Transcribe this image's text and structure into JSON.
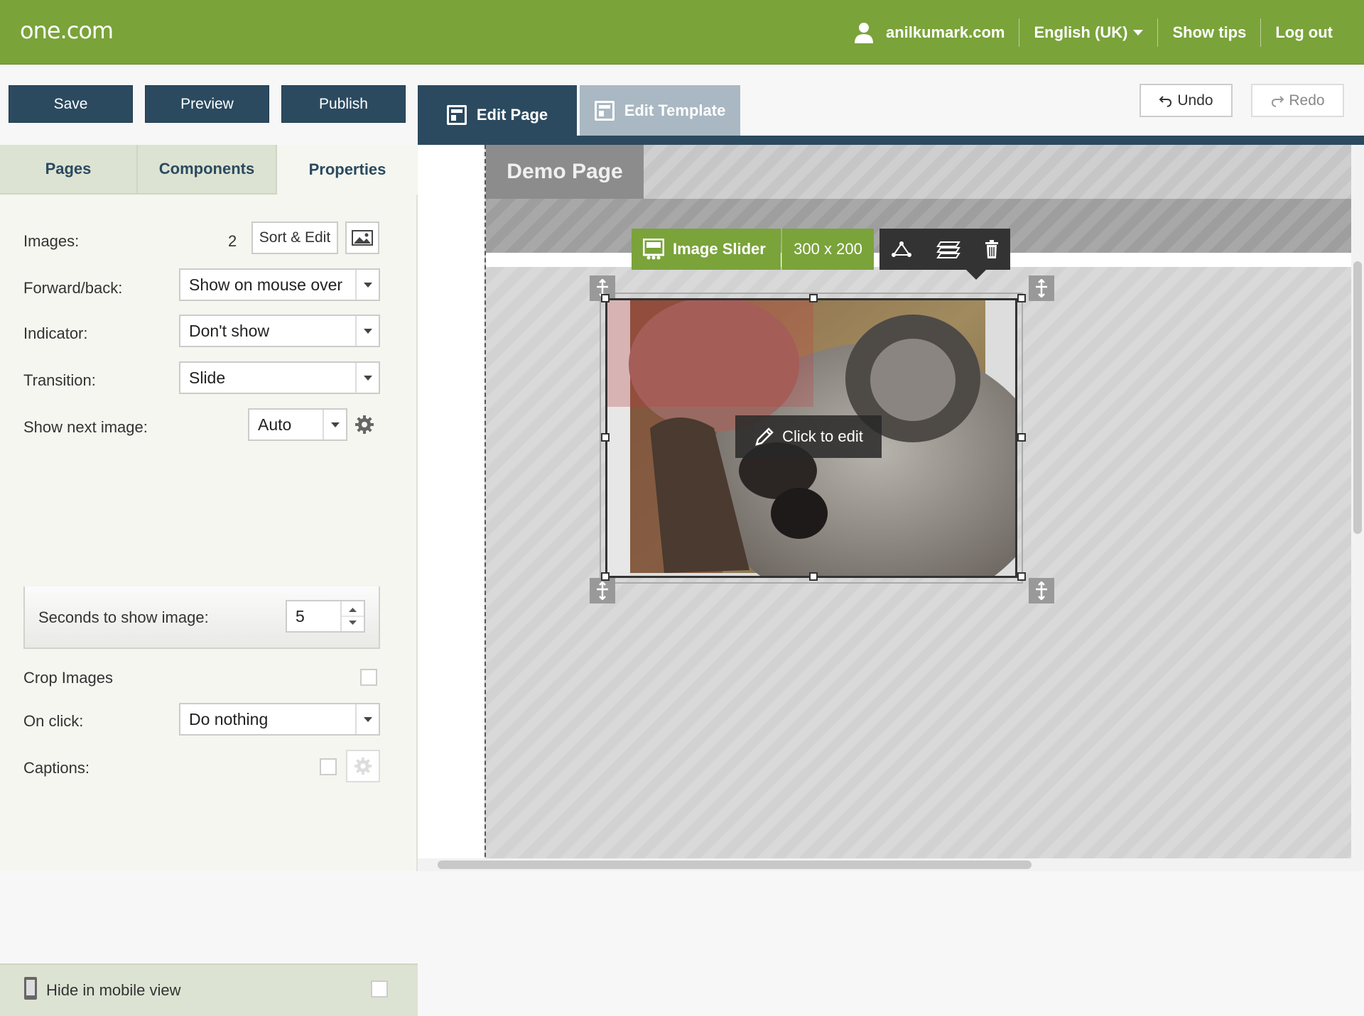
{
  "brand": {
    "logo": "one.com"
  },
  "topnav": {
    "user": "anilkumark.com",
    "language": "English (UK)",
    "show_tips": "Show tips",
    "logout": "Log out"
  },
  "toolbar": {
    "save": "Save",
    "preview": "Preview",
    "publish": "Publish",
    "edit_page": "Edit Page",
    "edit_template": "Edit Template",
    "undo": "Undo",
    "redo": "Redo"
  },
  "panel": {
    "tabs": [
      "Pages",
      "Components",
      "Properties"
    ],
    "images_label": "Images:",
    "images_count": "2",
    "sort_edit": "Sort & Edit",
    "forward_back_label": "Forward/back:",
    "forward_back_value": "Show on mouse over",
    "indicator_label": "Indicator:",
    "indicator_value": "Don't show",
    "transition_label": "Transition:",
    "transition_value": "Slide",
    "show_next_label": "Show next image:",
    "show_next_value": "Auto",
    "seconds_label": "Seconds to show image:",
    "seconds_value": "5",
    "crop_label": "Crop Images",
    "onclick_label": "On click:",
    "onclick_value": "Do nothing",
    "captions_label": "Captions:",
    "hide_mobile": "Hide in mobile view"
  },
  "canvas": {
    "page_tab": "Demo Page",
    "component_name": "Image Slider",
    "component_size": "300 x 200",
    "click_to_edit": "Click to edit"
  },
  "colors": {
    "brand_green": "#7aa33a",
    "navy": "#2b4a5f"
  }
}
